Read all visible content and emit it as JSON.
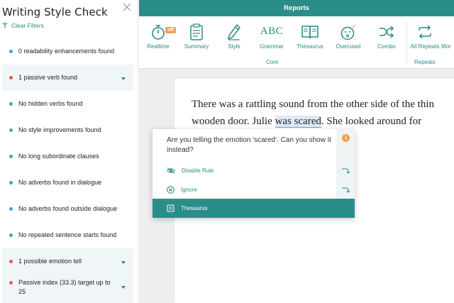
{
  "sidebar": {
    "title": "Writing Style Check",
    "clear_filters": "Clear Filters",
    "items": [
      {
        "label": "0 readability enhancements found",
        "color": "#3ba7d3",
        "expandable": false
      },
      {
        "label": "1 passive verb found",
        "color": "#e25b4a",
        "expandable": true
      },
      {
        "label": "No hidden verbs found",
        "color": "#2fb89a",
        "expandable": false
      },
      {
        "label": "No style improvements found",
        "color": "#2fb89a",
        "expandable": false
      },
      {
        "label": "No long subordinate clauses",
        "color": "#2fb89a",
        "expandable": false
      },
      {
        "label": "No adverbs found in dialogue",
        "color": "#3ba7d3",
        "expandable": false
      },
      {
        "label": "No adverbs found outside dialogue",
        "color": "#3ba7d3",
        "expandable": false
      },
      {
        "label": "No repeated sentence starts found",
        "color": "#2fb89a",
        "expandable": false
      },
      {
        "label": "1 possible emotion tell",
        "color": "#e25b4a",
        "expandable": true
      },
      {
        "label": "Passive index (33.3) target up to 25",
        "color": "#e25b4a",
        "expandable": true
      }
    ]
  },
  "header": {
    "title": "Reports"
  },
  "toolbar": {
    "tools": [
      {
        "label": "Realtime",
        "icon": "stopwatch-icon",
        "badge": "off"
      },
      {
        "label": "Summary",
        "icon": "clipboard-icon"
      },
      {
        "label": "Style",
        "icon": "pen-icon"
      },
      {
        "label": "Grammar",
        "icon": "abc-check-icon",
        "glyph": "ABC"
      },
      {
        "label": "Thesaurus",
        "icon": "book-icon"
      },
      {
        "label": "Overused",
        "icon": "sleepy-face-icon"
      },
      {
        "label": "Combo",
        "icon": "shuffle-icon"
      },
      {
        "label": "All Repeats",
        "icon": "repeat-icon"
      },
      {
        "label": "Mor",
        "icon": "more-icon"
      }
    ],
    "groups": [
      {
        "label": "Core"
      },
      {
        "label": "Repeats"
      }
    ]
  },
  "document": {
    "before": "There was a rattling sound from the other side of the thin wooden door. Julie ",
    "highlight": "was scared",
    "after": ". She looked around for another way out,"
  },
  "popup": {
    "message": "Are you telling the emotion 'scared'. Can you show it instead?",
    "info": "i",
    "actions": [
      {
        "label": "Disable Rule",
        "icon": "eye-off-icon"
      },
      {
        "label": "Ignore",
        "icon": "circle-x-icon"
      }
    ],
    "thesaurus": {
      "label": "Thesaurus",
      "icon": "book-icon"
    }
  },
  "colors": {
    "accent": "#2b8d89",
    "badge": "#f0a14a",
    "error": "#e25b4a",
    "ok": "#2fb89a",
    "info": "#3ba7d3"
  }
}
